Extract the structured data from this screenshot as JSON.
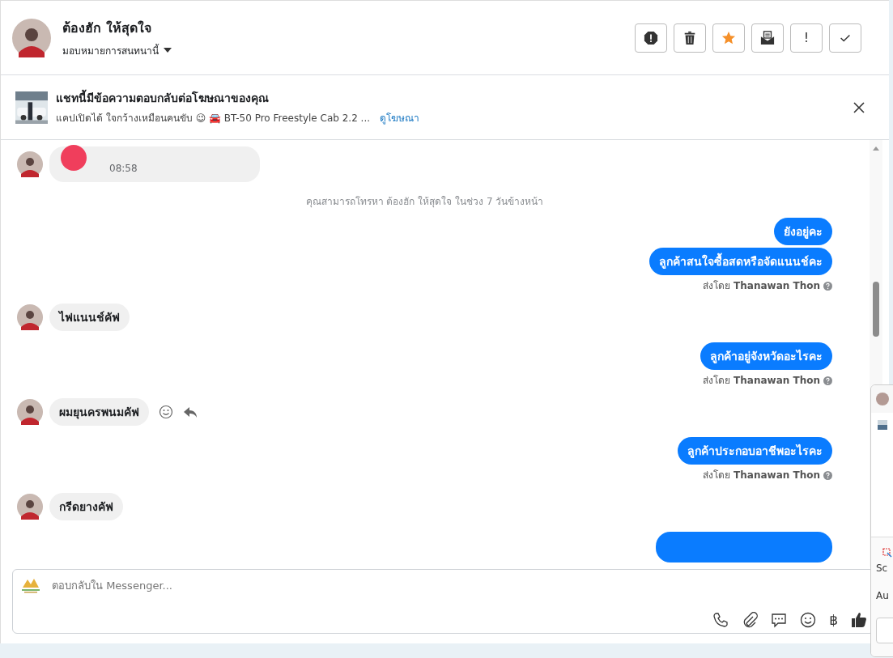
{
  "header": {
    "name": "ต้องฮัก ให้สุดใจ",
    "assign_label": "มอบหมายการสนทนานี้",
    "actions": [
      {
        "kind": "alert"
      },
      {
        "kind": "trash"
      },
      {
        "kind": "star"
      },
      {
        "kind": "mail"
      },
      {
        "kind": "text",
        "label": "!"
      },
      {
        "kind": "check"
      }
    ]
  },
  "ad_banner": {
    "title": "แชทนี้มีข้อความตอบกลับต่อโฆษณาของคุณ",
    "snippet": "แคปเปิดได้ ใจกว้างเหมือนคนขับ 😉 🚘 BT-50 Pro Freestyle Cab 2.2 ...",
    "link": "ดูโฆษณา"
  },
  "messages": [
    {
      "kind": "call",
      "time": "08:58"
    },
    {
      "kind": "notice",
      "text": "คุณสามารถโทรหา ต้องฮัก ให้สุดใจ ในช่วง 7 วันข้างหน้า"
    },
    {
      "kind": "outgoing",
      "texts": [
        "ยังอยู่คะ",
        "ลูกค้าสนใจซื้อสดหรือจัดแนนช์คะ"
      ],
      "sent_by": "ส่งโดย **Thanawan Thon**"
    },
    {
      "kind": "incoming",
      "text": "ไฟแนนช์คัฟ",
      "hover_actions": false
    },
    {
      "kind": "outgoing",
      "texts": [
        "ลูกค้าอยู่จังหวัดอะไรคะ"
      ],
      "sent_by": "ส่งโดย **Thanawan Thon**"
    },
    {
      "kind": "incoming",
      "text": "ผมยุนครพนมคัฟ",
      "hover_actions": true
    },
    {
      "kind": "outgoing",
      "texts": [
        "ลูกค้าประกอบอาชีพอะไรคะ"
      ],
      "sent_by": "ส่งโดย **Thanawan Thon**"
    },
    {
      "kind": "incoming",
      "text": "กรีดยางคัฟ",
      "hover_actions": false
    },
    {
      "kind": "outgoing_hidden"
    }
  ],
  "composer": {
    "placeholder": "ตอบกลับใน Messenger...",
    "tools": [
      {
        "kind": "phone"
      },
      {
        "kind": "clip"
      },
      {
        "kind": "chat"
      },
      {
        "kind": "smile"
      },
      {
        "kind": "text",
        "label": "฿"
      },
      {
        "kind": "like"
      }
    ]
  },
  "popup": {
    "lines": [
      "Sc",
      "Au"
    ]
  }
}
